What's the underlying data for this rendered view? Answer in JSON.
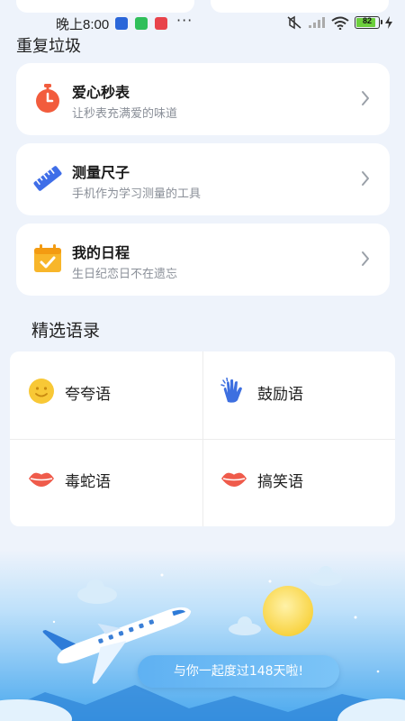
{
  "status_bar": {
    "time": "晚上8:00",
    "dots": "···",
    "battery": "82"
  },
  "sections": {
    "trash_title": "重复垃圾",
    "quotes_title": "精选语录"
  },
  "tools": [
    {
      "title": "爱心秒表",
      "subtitle": "让秒表充满爱的味道",
      "icon": "stopwatch-icon"
    },
    {
      "title": "测量尺子",
      "subtitle": "手机作为学习测量的工具",
      "icon": "ruler-icon"
    },
    {
      "title": "我的日程",
      "subtitle": "生日纪恋日不在遗忘",
      "icon": "calendar-icon"
    }
  ],
  "quotes": [
    {
      "label": "夸夸语",
      "icon": "smiley-icon"
    },
    {
      "label": "鼓励语",
      "icon": "clapping-hands-icon"
    },
    {
      "label": "毒蛇语",
      "icon": "lips-icon"
    },
    {
      "label": "搞笑语",
      "icon": "lips-icon"
    }
  ],
  "banner": {
    "days_text": "与你一起度过148天啦!"
  },
  "colors": {
    "background": "#eef3fb",
    "stopwatch": "#f25c3d",
    "ruler": "#3f6ee8",
    "calendar": "#f8b62a",
    "smiley": "#f8c836",
    "lips": "#ef5b4b",
    "pill": "#6ab9f4"
  }
}
